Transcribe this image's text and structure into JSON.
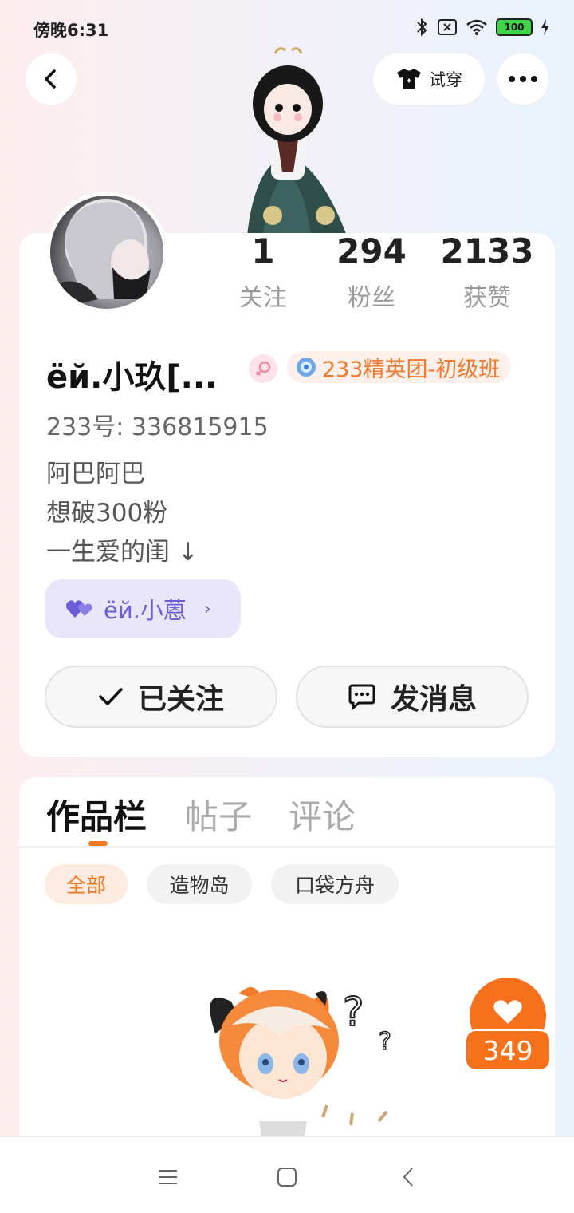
{
  "status_bar": {
    "time": "傍晚6:31",
    "battery": "100"
  },
  "header": {
    "tryon_label": "试穿"
  },
  "stats": [
    {
      "value": "1",
      "label": "关注"
    },
    {
      "value": "294",
      "label": "粉丝"
    },
    {
      "value": "2133",
      "label": "获赞"
    }
  ],
  "profile": {
    "name": "ёй.小玖[...",
    "badge": "233精英团-初级班",
    "uid": "233号: 336815915",
    "bio": [
      "阿巴阿巴",
      "想破300粉",
      "一生爱的闺 ↓"
    ],
    "bff_name": "ёй.小蒽"
  },
  "actions": {
    "followed_label": "已关注",
    "message_label": "发消息"
  },
  "tabs": [
    "作品栏",
    "帖子",
    "评论"
  ],
  "filters": [
    "全部",
    "造物岛",
    "口袋方舟"
  ],
  "like": {
    "count": "349"
  },
  "colors": {
    "accent": "#f7701c",
    "bff_bg": "#e9e6fb",
    "bff_text": "#6b5cd8"
  }
}
